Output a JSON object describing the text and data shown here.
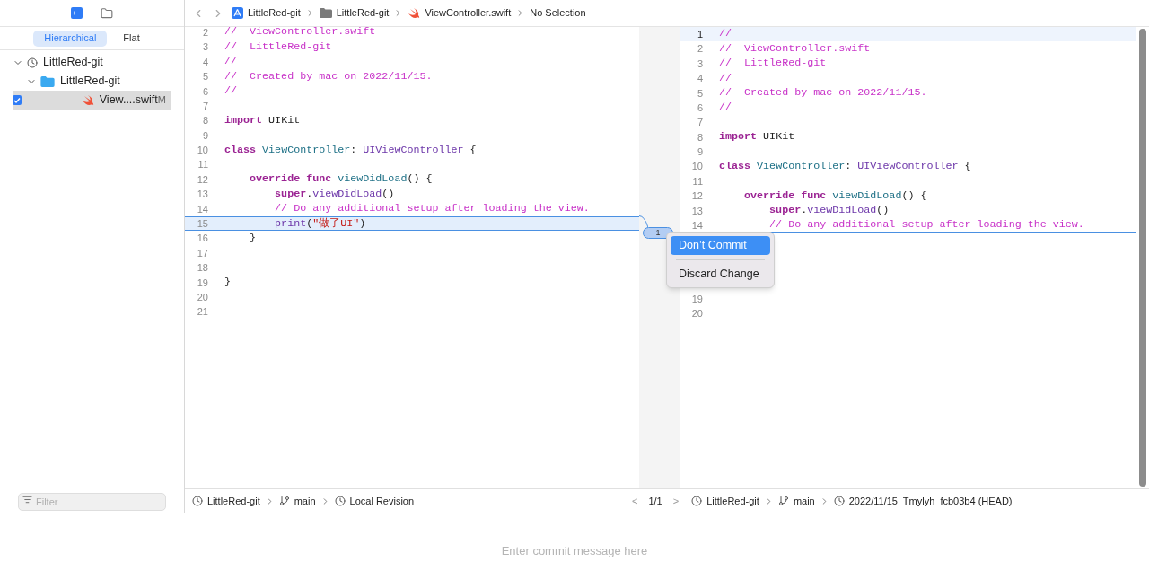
{
  "sidebar": {
    "toolbar": [
      {
        "kind": "changes",
        "selected": true
      },
      {
        "kind": "folder",
        "selected": false
      }
    ],
    "view_modes": [
      {
        "label": "Hierarchical",
        "selected": true
      },
      {
        "label": "Flat",
        "selected": false
      }
    ],
    "tree": [
      {
        "label": "LittleRed-git",
        "kind": "repo",
        "expanded": true,
        "children": [
          {
            "label": "LittleRed-git",
            "kind": "folder",
            "expanded": true,
            "children": [
              {
                "label": "View....swift",
                "kind": "swift",
                "status": "M",
                "checked": true,
                "selected": true
              }
            ]
          }
        ]
      }
    ],
    "filter": {
      "placeholder": "Filter"
    }
  },
  "breadcrumb": [
    {
      "label": "LittleRed-git",
      "kind": "app"
    },
    {
      "label": "LittleRed-git",
      "kind": "folder"
    },
    {
      "label": "ViewController.swift",
      "kind": "swift"
    },
    {
      "label": "No Selection",
      "kind": "none"
    }
  ],
  "left_editor": {
    "lines": [
      {
        "num": "2",
        "tokens": [
          {
            "kind": "comment",
            "text": "//  ViewController.swift"
          }
        ]
      },
      {
        "num": "3",
        "tokens": [
          {
            "kind": "comment",
            "text": "//  LittleRed-git"
          }
        ]
      },
      {
        "num": "4",
        "tokens": [
          {
            "kind": "comment",
            "text": "//"
          }
        ]
      },
      {
        "num": "5",
        "tokens": [
          {
            "kind": "comment",
            "text": "//  Created by mac on 2022/11/15."
          }
        ]
      },
      {
        "num": "6",
        "tokens": [
          {
            "kind": "comment",
            "text": "//"
          }
        ]
      },
      {
        "num": "7"
      },
      {
        "num": "8",
        "tokens": [
          {
            "kind": "keyword",
            "text": "import"
          },
          {
            "kind": "plain",
            "text": " UIKit"
          }
        ]
      },
      {
        "num": "9"
      },
      {
        "num": "10",
        "tokens": [
          {
            "kind": "keyword",
            "text": "class "
          },
          {
            "kind": "decl",
            "text": "ViewController"
          },
          {
            "kind": "plain",
            "text": ": "
          },
          {
            "kind": "type",
            "text": "UIViewController"
          },
          {
            "kind": "plain",
            "text": " {"
          }
        ]
      },
      {
        "num": "11"
      },
      {
        "num": "12",
        "tokens": [
          {
            "kind": "keyword",
            "text": "    override func "
          },
          {
            "kind": "decl",
            "text": "viewDidLoad"
          },
          {
            "kind": "plain",
            "text": "() {"
          }
        ]
      },
      {
        "num": "13",
        "tokens": [
          {
            "kind": "keyword",
            "text": "        super"
          },
          {
            "kind": "plain",
            "text": "."
          },
          {
            "kind": "call",
            "text": "viewDidLoad"
          },
          {
            "kind": "plain",
            "text": "()"
          }
        ]
      },
      {
        "num": "14",
        "tokens": [
          {
            "kind": "comment",
            "text": "        // Do any additional setup after loading the view."
          }
        ]
      },
      {
        "num": "15",
        "changed": true,
        "tokens": [
          {
            "kind": "call",
            "text": "        print"
          },
          {
            "kind": "plain",
            "text": "("
          },
          {
            "kind": "string",
            "text": "\"做了UI\""
          },
          {
            "kind": "plain",
            "text": ")"
          }
        ]
      },
      {
        "num": "16",
        "tokens": [
          {
            "kind": "plain",
            "text": "    }"
          }
        ]
      },
      {
        "num": "17"
      },
      {
        "num": "18"
      },
      {
        "num": "19",
        "tokens": [
          {
            "kind": "plain",
            "text": "}"
          }
        ]
      },
      {
        "num": "20"
      },
      {
        "num": "21"
      }
    ]
  },
  "change_badge": "1",
  "right_editor": {
    "lines": [
      {
        "num": "1",
        "current": true,
        "tokens": [
          {
            "kind": "comment",
            "text": "//"
          }
        ]
      },
      {
        "num": "2",
        "tokens": [
          {
            "kind": "comment",
            "text": "//  ViewController.swift"
          }
        ]
      },
      {
        "num": "3",
        "tokens": [
          {
            "kind": "comment",
            "text": "//  LittleRed-git"
          }
        ]
      },
      {
        "num": "4",
        "tokens": [
          {
            "kind": "comment",
            "text": "//"
          }
        ]
      },
      {
        "num": "5",
        "tokens": [
          {
            "kind": "comment",
            "text": "//  Created by mac on 2022/11/15."
          }
        ]
      },
      {
        "num": "6",
        "tokens": [
          {
            "kind": "comment",
            "text": "//"
          }
        ]
      },
      {
        "num": "7"
      },
      {
        "num": "8",
        "tokens": [
          {
            "kind": "keyword",
            "text": "import"
          },
          {
            "kind": "plain",
            "text": " UIKit"
          }
        ]
      },
      {
        "num": "9"
      },
      {
        "num": "10",
        "tokens": [
          {
            "kind": "keyword",
            "text": "class "
          },
          {
            "kind": "decl",
            "text": "ViewController"
          },
          {
            "kind": "plain",
            "text": ": "
          },
          {
            "kind": "type",
            "text": "UIViewController"
          },
          {
            "kind": "plain",
            "text": " {"
          }
        ]
      },
      {
        "num": "11"
      },
      {
        "num": "12",
        "tokens": [
          {
            "kind": "keyword",
            "text": "    override func "
          },
          {
            "kind": "decl",
            "text": "viewDidLoad"
          },
          {
            "kind": "plain",
            "text": "() {"
          }
        ]
      },
      {
        "num": "13",
        "tokens": [
          {
            "kind": "keyword",
            "text": "        super"
          },
          {
            "kind": "plain",
            "text": "."
          },
          {
            "kind": "call",
            "text": "viewDidLoad"
          },
          {
            "kind": "plain",
            "text": "()"
          }
        ]
      },
      {
        "num": "14",
        "removed_below": true,
        "tokens": [
          {
            "kind": "comment",
            "text": "        // Do any additional setup after loading the view."
          }
        ]
      },
      {
        "num": "19"
      },
      {
        "num": "20"
      }
    ]
  },
  "popup_menu": [
    {
      "label": "Don’t Commit",
      "selected": true
    },
    {
      "label": "Discard Change",
      "selected": false
    }
  ],
  "left_path": [
    {
      "label": "LittleRed-git",
      "kind": "repo"
    },
    {
      "label": "main",
      "kind": "branch"
    },
    {
      "label": "Local Revision",
      "kind": "revision"
    }
  ],
  "pager": {
    "prev": "<",
    "count": "1/1",
    "next": ">"
  },
  "right_path": [
    {
      "label": "LittleRed-git",
      "kind": "repo"
    },
    {
      "label": "main",
      "kind": "branch"
    },
    {
      "label": "2022/11/15  Tmylyh  fcb03b4 (HEAD)",
      "kind": "revision"
    }
  ],
  "commit": {
    "placeholder": "Enter commit message here"
  }
}
